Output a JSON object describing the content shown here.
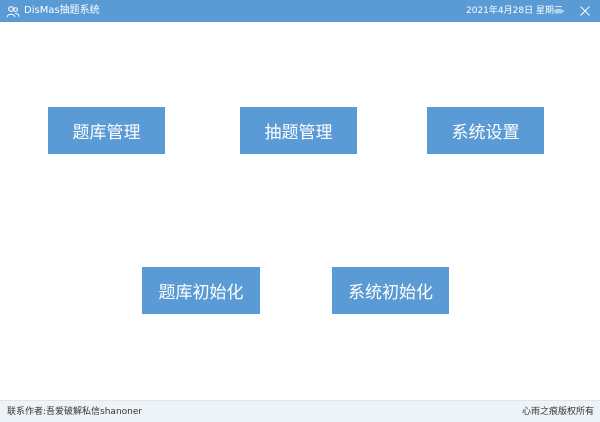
{
  "window": {
    "title": "DisMas抽题系统",
    "datetime": "2021年4月28日 星期三",
    "icons": {
      "app": "app-users-icon",
      "minimize": "minimize-icon",
      "close": "close-icon"
    }
  },
  "menu": {
    "question_bank_management": "题库管理",
    "question_drawing_management": "抽题管理",
    "system_settings": "系统设置",
    "question_bank_initialization": "题库初始化",
    "system_initialization": "系统初始化"
  },
  "status_bar": {
    "author": "联系作者:吾爱破解私信shanoner",
    "copyright": "心雨之痕版权所有"
  },
  "colors": {
    "accent": "#5b9bd5",
    "status_bg": "#eef3f8",
    "text_on_accent": "#ffffff"
  }
}
